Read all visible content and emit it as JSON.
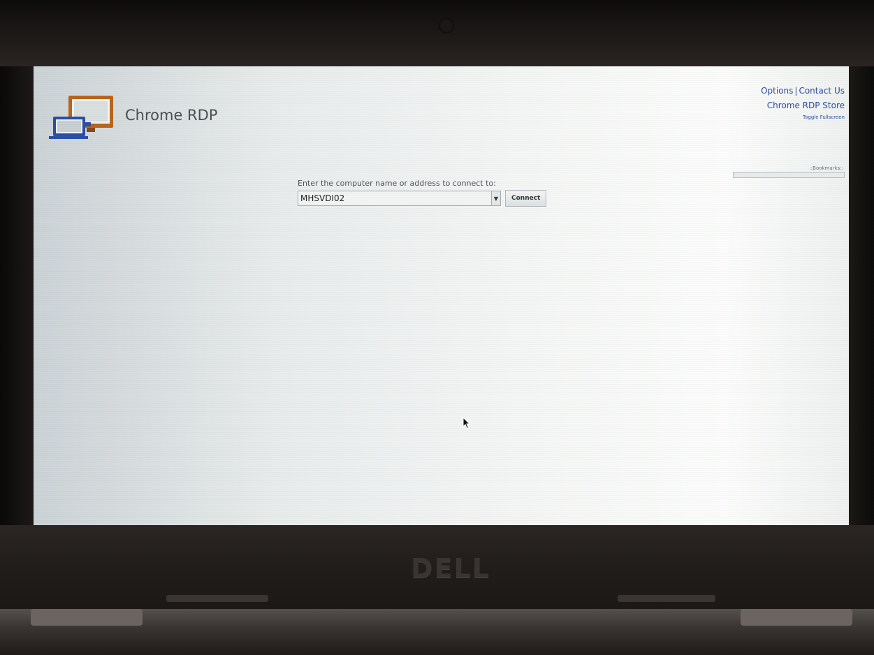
{
  "app": {
    "title": "Chrome RDP"
  },
  "top_links": {
    "options": "Options",
    "separator": "|",
    "contact_us": "Contact Us",
    "store": "Chrome RDP Store",
    "toggle_fullscreen": "Toggle Fullscreen"
  },
  "bookmarks": {
    "label": "::Bookmarks::"
  },
  "connect": {
    "prompt": "Enter the computer name or address to connect to:",
    "address_value": "MHSVDI02",
    "dropdown_icon": "triangle-down",
    "button_label": "Connect"
  },
  "hardware": {
    "brand": "DELL"
  },
  "colors": {
    "link": "#2e4c9a",
    "logo_orange": "#b9651c",
    "logo_blue": "#2a4fa8"
  }
}
